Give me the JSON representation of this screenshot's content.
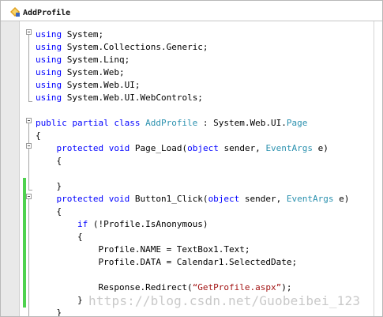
{
  "document_tab": {
    "title": "AddProfile",
    "icon": "csharp-class-icon"
  },
  "code_lines": [
    [
      {
        "t": "using",
        "c": "kw"
      },
      {
        "t": " System;",
        "c": "pl"
      }
    ],
    [
      {
        "t": "using",
        "c": "kw"
      },
      {
        "t": " System.Collections.Generic;",
        "c": "pl"
      }
    ],
    [
      {
        "t": "using",
        "c": "kw"
      },
      {
        "t": " System.Linq;",
        "c": "pl"
      }
    ],
    [
      {
        "t": "using",
        "c": "kw"
      },
      {
        "t": " System.Web;",
        "c": "pl"
      }
    ],
    [
      {
        "t": "using",
        "c": "kw"
      },
      {
        "t": " System.Web.UI;",
        "c": "pl"
      }
    ],
    [
      {
        "t": "using",
        "c": "kw"
      },
      {
        "t": " System.Web.UI.WebControls;",
        "c": "pl"
      }
    ],
    [
      {
        "t": "",
        "c": "pl"
      }
    ],
    [
      {
        "t": "public partial class ",
        "c": "kw"
      },
      {
        "t": "AddProfile",
        "c": "ty"
      },
      {
        "t": " : System.Web.UI.",
        "c": "pl"
      },
      {
        "t": "Page",
        "c": "ty"
      }
    ],
    [
      {
        "t": "{",
        "c": "pl"
      }
    ],
    [
      {
        "t": "    ",
        "c": "pl"
      },
      {
        "t": "protected void",
        "c": "kw"
      },
      {
        "t": " Page_Load(",
        "c": "pl"
      },
      {
        "t": "object",
        "c": "kw"
      },
      {
        "t": " sender, ",
        "c": "pl"
      },
      {
        "t": "EventArgs",
        "c": "ty"
      },
      {
        "t": " e)",
        "c": "pl"
      }
    ],
    [
      {
        "t": "    {",
        "c": "pl"
      }
    ],
    [
      {
        "t": "",
        "c": "pl"
      }
    ],
    [
      {
        "t": "    }",
        "c": "pl"
      }
    ],
    [
      {
        "t": "    ",
        "c": "pl"
      },
      {
        "t": "protected void",
        "c": "kw"
      },
      {
        "t": " Button1_Click(",
        "c": "pl"
      },
      {
        "t": "object",
        "c": "kw"
      },
      {
        "t": " sender, ",
        "c": "pl"
      },
      {
        "t": "EventArgs",
        "c": "ty"
      },
      {
        "t": " e)",
        "c": "pl"
      }
    ],
    [
      {
        "t": "    {",
        "c": "pl"
      }
    ],
    [
      {
        "t": "        ",
        "c": "pl"
      },
      {
        "t": "if",
        "c": "kw"
      },
      {
        "t": " (!Profile.IsAnonymous)",
        "c": "pl"
      }
    ],
    [
      {
        "t": "        {",
        "c": "pl"
      }
    ],
    [
      {
        "t": "            Profile.NAME = TextBox1.Text;",
        "c": "pl"
      }
    ],
    [
      {
        "t": "            Profile.DATA = Calendar1.SelectedDate;",
        "c": "pl"
      }
    ],
    [
      {
        "t": "",
        "c": "pl"
      }
    ],
    [
      {
        "t": "            Response.Redirect(",
        "c": "pl"
      },
      {
        "t": "“GetProfile.aspx”",
        "c": "st"
      },
      {
        "t": ");",
        "c": "pl"
      }
    ],
    [
      {
        "t": "        }",
        "c": "pl"
      }
    ],
    [
      {
        "t": "    }",
        "c": "pl"
      }
    ]
  ],
  "watermark": "https://blog.csdn.net/Guobeibei_123"
}
